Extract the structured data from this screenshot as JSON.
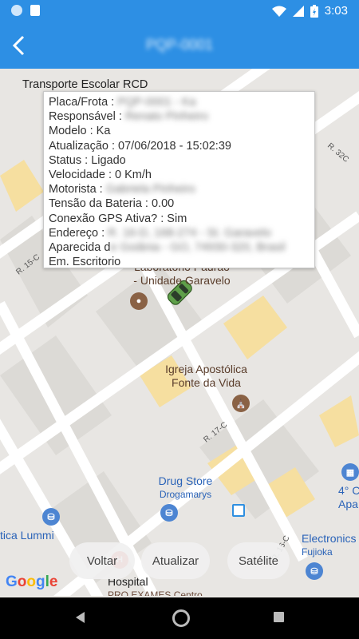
{
  "status_bar": {
    "time": "3:03"
  },
  "app_bar": {
    "title": "PQP-0001"
  },
  "map": {
    "vehicle_title": "Transporte Escolar RCD",
    "info": {
      "placa": "Placa/Frota : PQP-0001 - Ka",
      "responsavel": "Responsável : Renato Pinheiro",
      "modelo": "Modelo : Ka",
      "atualizacao": "Atualização : 07/06/2018 - 15:02:39",
      "status": "Status : Ligado",
      "velocidade": "Velocidade : 0 Km/h",
      "motorista": "Motorista : Gabriela Pinheiro",
      "tensao": "Tensão da Bateria : 0.00",
      "gps": "Conexão GPS Ativa? : Sim",
      "endereco_a": "Endereço : R. 16-D, 168-274 - St. Garavelo",
      "endereco_b": "Aparecida de Goiânia - GO, 74930-320, Brasil",
      "local": "Em. Escritorio"
    },
    "labels": {
      "lab_a": "Laboratório Padrão",
      "lab_b": "- Unidade Garavelo",
      "igreja_a": "Igreja Apostólica",
      "igreja_b": "Fonte da Vida",
      "drug_a": "Drug Store",
      "drug_b": "Drogamarys",
      "otica": "tica Lummi",
      "electronics_a": "Electronics",
      "electronics_b": "Fujioka",
      "quarto_a": "4° C",
      "quarto_b": "Apa",
      "hospital": "Hospital",
      "pro_exames": "PRO EXAMES Centro",
      "r15c": "R. 15-C",
      "r17c": "R. 17-C",
      "r32c": "R. 32C",
      "r16c": "R. 16-C"
    },
    "buttons": {
      "voltar": "Voltar",
      "atualizar": "Atualizar",
      "satelite": "Satélite"
    },
    "google": "Google"
  },
  "colors": {
    "primary": "#2d8fe4",
    "car": "#5fa04a"
  }
}
